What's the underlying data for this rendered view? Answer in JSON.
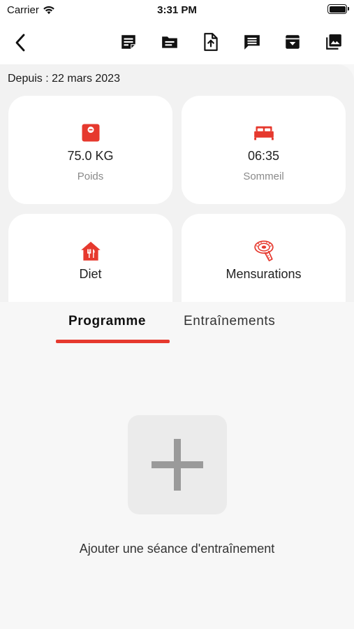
{
  "status_bar": {
    "carrier": "Carrier",
    "time": "3:31 PM"
  },
  "nav": {
    "back_icon": "chevron-left-icon",
    "actions": [
      "note-icon",
      "folder-icon",
      "file-upload-icon",
      "chat-icon",
      "archive-icon",
      "photo-library-icon"
    ]
  },
  "since": "Depuis : 22 mars 2023",
  "cards": {
    "weight": {
      "value": "75.0 KG",
      "label": "Poids",
      "icon": "scale-icon"
    },
    "sleep": {
      "value": "06:35",
      "label": "Sommeil",
      "icon": "bed-icon"
    },
    "diet": {
      "value": "Diet",
      "icon": "restaurant-icon"
    },
    "measurements": {
      "value": "Mensurations",
      "icon": "tape-measure-icon"
    }
  },
  "tabs": [
    {
      "label": "Programme",
      "active": true
    },
    {
      "label": "Entraînements",
      "active": false
    }
  ],
  "empty_state": {
    "button_icon": "plus-icon",
    "label": "Ajouter une séance d'entraînement"
  },
  "colors": {
    "accent": "#e6392e",
    "icon_dark": "#111111",
    "plus_gray": "#9a9a9a"
  }
}
